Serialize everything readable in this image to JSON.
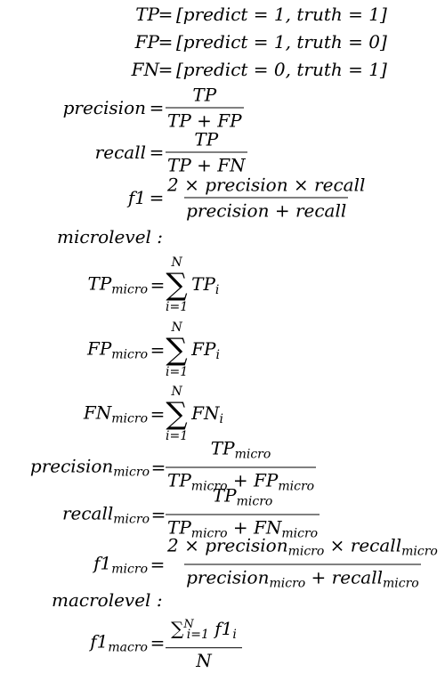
{
  "defs": {
    "tp": {
      "lhs": "TP",
      "rhs": "[predict = 1, truth = 1]"
    },
    "fp": {
      "lhs": "FP",
      "rhs": "[predict = 1, truth = 0]"
    },
    "fn": {
      "lhs": "FN",
      "rhs": "[predict = 0, truth = 1]"
    }
  },
  "basic": {
    "precision": {
      "lhs": "precision",
      "num": "TP",
      "den": "TP + FP"
    },
    "recall": {
      "lhs": "recall",
      "num": "TP",
      "den": "TP + FN"
    },
    "f1": {
      "lhs": "f1",
      "num": "2 × precision × recall",
      "den": "precision + recall"
    }
  },
  "micro_heading": "microlevel :",
  "micro": {
    "tp": {
      "lhs": "TP",
      "sub": "micro",
      "upper": "N",
      "lower": "i=1",
      "term": "TP",
      "term_sub": "i"
    },
    "fp": {
      "lhs": "FP",
      "sub": "micro",
      "upper": "N",
      "lower": "i=1",
      "term": "FP",
      "term_sub": "i"
    },
    "fn": {
      "lhs": "FN",
      "sub": "micro",
      "upper": "N",
      "lower": "i=1",
      "term": "FN",
      "term_sub": "i"
    },
    "precision": {
      "lhs": "precision",
      "sub": "micro",
      "num": "TP",
      "num_sub": "micro",
      "den1": "TP",
      "den1_sub": "micro",
      "den_op": " + ",
      "den2": "FP",
      "den2_sub": "micro"
    },
    "recall": {
      "lhs": "recall",
      "sub": "micro",
      "num": "TP",
      "num_sub": "micro",
      "den1": "TP",
      "den1_sub": "micro",
      "den_op": " + ",
      "den2": "FN",
      "den2_sub": "micro"
    },
    "f1": {
      "lhs": "f1",
      "sub": "micro",
      "num1": "2 × precision",
      "num1_sub": "micro",
      "num_op": " × recall",
      "num2_sub": "micro",
      "den1": "precision",
      "den1_sub": "micro",
      "den_op": " + recall",
      "den2_sub": "micro"
    }
  },
  "macro_heading": "macrolevel :",
  "macro": {
    "f1": {
      "lhs": "f1",
      "sub": "macro",
      "sum": "∑",
      "upper": "N",
      "lower": "i=1",
      "term": "f1",
      "term_sub": "i",
      "den": "N"
    }
  },
  "equals": "="
}
